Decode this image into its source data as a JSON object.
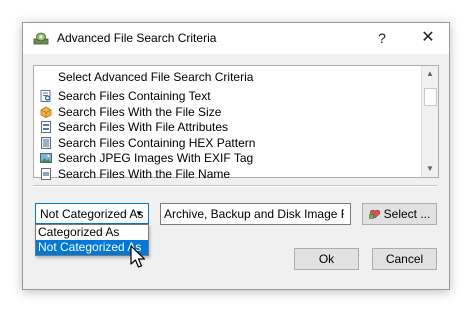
{
  "window": {
    "title": "Advanced File Search Criteria",
    "help_label": "?",
    "close_label": "✕"
  },
  "criteria_list": {
    "header": "Select Advanced File Search Criteria",
    "items": [
      {
        "label": "Search Files Containing Text",
        "icon": "text-search-icon"
      },
      {
        "label": "Search Files With the File Size",
        "icon": "file-size-icon"
      },
      {
        "label": "Search Files With File Attributes",
        "icon": "file-attributes-icon"
      },
      {
        "label": "Search Files Containing HEX Pattern",
        "icon": "hex-pattern-icon"
      },
      {
        "label": "Search JPEG Images With EXIF Tag",
        "icon": "jpeg-image-icon"
      },
      {
        "label": "Search Files With the File Name",
        "icon": "file-name-icon"
      }
    ]
  },
  "category_combo": {
    "value": "Not Categorized As",
    "options": [
      {
        "label": "Categorized As",
        "selected": false
      },
      {
        "label": "Not Categorized As",
        "selected": true
      }
    ]
  },
  "category_field": {
    "value": "Archive, Backup and Disk Image Files"
  },
  "buttons": {
    "select": "Select ...",
    "ok": "Ok",
    "cancel": "Cancel"
  },
  "colors": {
    "accent": "#0078d7",
    "dialog_bg": "#f0f0f0",
    "button_bg": "#e1e1e1"
  }
}
